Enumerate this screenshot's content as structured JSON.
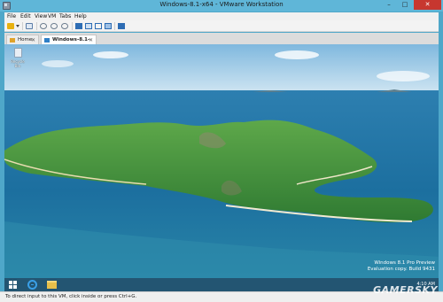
{
  "window": {
    "title": "Windows-8.1-x64 - VMware Workstation",
    "controls": {
      "minimize": "–",
      "maximize": "□",
      "close": "✕"
    }
  },
  "menu": {
    "items": [
      "File",
      "Edit",
      "View",
      "VM",
      "Tabs",
      "Help"
    ]
  },
  "toolbar": {
    "icons": [
      "power-icon",
      "dropdown-caret-icon",
      "send-ctrl-alt-del-icon",
      "snapshot-take-icon",
      "snapshot-revert-icon",
      "snapshot-manager-icon",
      "view-library-icon",
      "view-thumbnail-icon",
      "view-console-icon",
      "view-fullscreen-icon",
      "view-unity-icon"
    ]
  },
  "tabs": [
    {
      "label": "Home",
      "close": "✕"
    },
    {
      "label": "Windows-8.1-x64",
      "close": "✕",
      "active": true
    }
  ],
  "guest": {
    "desktop_icons": [
      {
        "label": "Recycle Bin",
        "icon": "recycle-bin-icon"
      }
    ],
    "watermark": {
      "line1": "Windows 8.1 Pro Preview",
      "line2": "Evaluation copy. Build 9431",
      "line3": "4:10 AM"
    },
    "taskbar": {
      "apps": [
        "windows-start-icon",
        "internet-explorer-icon",
        "file-explorer-icon"
      ]
    }
  },
  "statusbar": {
    "message": "To direct input to this VM, click inside or press Ctrl+G."
  },
  "overlay": {
    "brand": "GAMERSKY"
  },
  "colors": {
    "titlebar": "#5fb6d8",
    "close_button": "#c7372f",
    "sea": "#1c74a9",
    "island": "#3f8f3a"
  }
}
